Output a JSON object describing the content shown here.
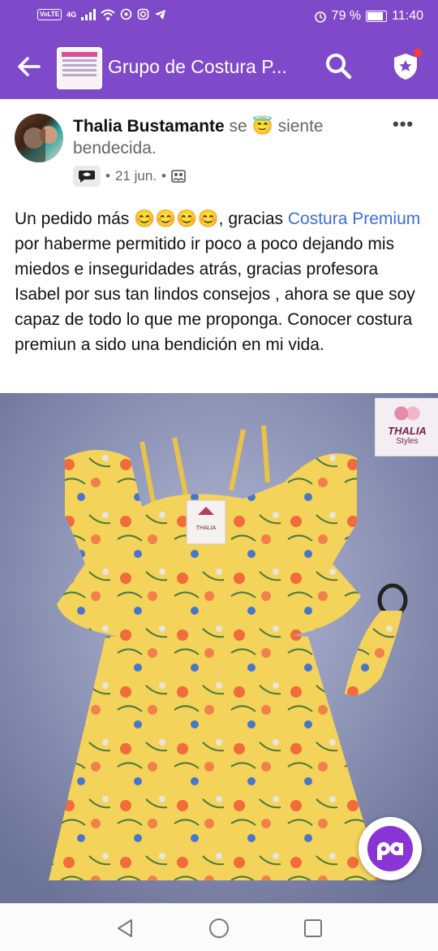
{
  "status_bar": {
    "carrier_badge": "VoLTE",
    "network": "4G",
    "battery_percent": "79 %",
    "battery_level": 0.79,
    "time": "11:40"
  },
  "app_bar": {
    "title": "Grupo de Costura P...",
    "colors": {
      "primary": "#7f4ac9",
      "notification_dot": "#ff3b30"
    },
    "icons": [
      "back-arrow-icon",
      "search-icon",
      "shield-star-icon"
    ]
  },
  "post": {
    "author_name": "Thalia Bustamante",
    "feeling_prefix": " se ",
    "feeling_emoji": "😇",
    "feeling_text": " siente bendecida.",
    "more_label": "•••",
    "date": "21 jun.",
    "separator": "•",
    "text_part1": "Un pedido más 😊😊😊😊, gracias ",
    "link_text": "Costura Premium",
    "text_part2": "  por haberme permitido ir poco a poco dejando mis miedos e inseguridades atrás, gracias profesora  Isabel por sus tan lindos consejos , ahora se que soy capaz de todo lo que me proponga. Conocer costura premiun a sido una bendición en mi vida.",
    "photo_watermark_title": "THALIA",
    "photo_watermark_subtitle": "Styles",
    "tag_text": "THALIA",
    "colors": {
      "link": "#3a6fd8",
      "dress": "#f3d35a"
    }
  },
  "fab": {
    "label": "pa",
    "color": "#8b34d6"
  },
  "nav": {
    "icons": [
      "back-triangle-icon",
      "home-circle-icon",
      "recents-square-icon"
    ]
  }
}
